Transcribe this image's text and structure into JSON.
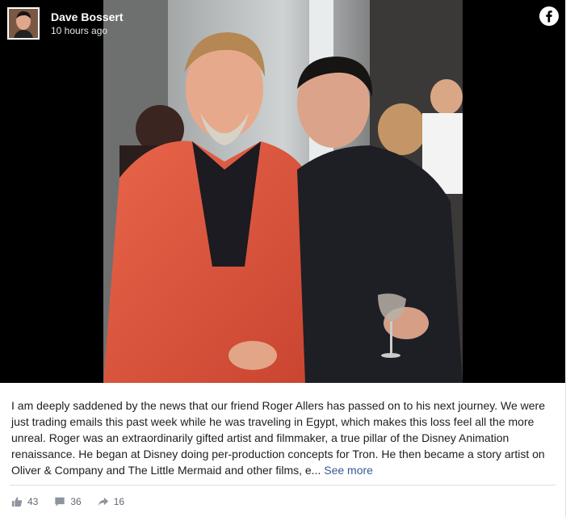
{
  "post": {
    "author": "Dave Bossert",
    "timestamp": "10 hours ago",
    "caption": "I am deeply saddened by the news that our friend Roger Allers has passed on to his next journey. We were just trading emails this past week while he was traveling in Egypt, which makes this loss feel all the more unreal. Roger was an extraordinarily gifted artist and filmmaker, a true pillar of the Disney Animation renaissance. He began at Disney doing per-production concepts for Tron. He then became a story artist on Oliver & Company and The Little Mermaid and other films, e...",
    "see_more": "See more"
  },
  "engagement": {
    "likes": "43",
    "comments": "36",
    "shares": "16"
  },
  "icons": {
    "platform": "facebook-icon",
    "like": "thumbs-up-icon",
    "comment": "speech-bubble-icon",
    "share": "share-arrow-icon"
  },
  "colors": {
    "link": "#385898",
    "text": "#1c1e21",
    "meta": "#606770"
  }
}
